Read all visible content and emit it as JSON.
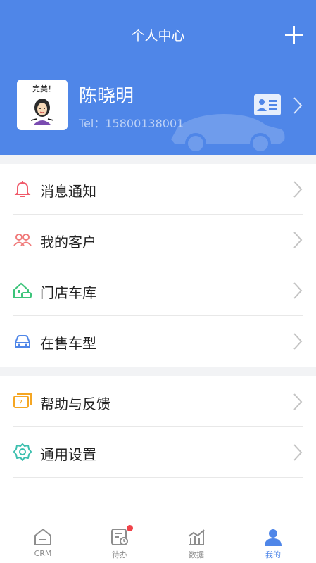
{
  "header": {
    "title": "个人中心",
    "user_name": "陈晓明",
    "user_tel": "Tel：15800138001",
    "avatar_caption": "完美！"
  },
  "menu": [
    {
      "label": "消息通知",
      "icon": "bell-icon",
      "color": "#f05a6a"
    },
    {
      "label": "我的客户",
      "icon": "customers-icon",
      "color": "#f07a7a"
    },
    {
      "label": "门店车库",
      "icon": "garage-icon",
      "color": "#3cc47a"
    },
    {
      "label": "在售车型",
      "icon": "car-icon",
      "color": "#4f86e8"
    },
    {
      "label": "帮助与反馈",
      "icon": "help-feedback-icon",
      "color": "#f5a623"
    },
    {
      "label": "通用设置",
      "icon": "settings-icon",
      "color": "#3cbfae"
    }
  ],
  "tabs": [
    {
      "label": "CRM",
      "icon": "home-icon"
    },
    {
      "label": "待办",
      "icon": "todo-icon"
    },
    {
      "label": "数据",
      "icon": "chart-icon"
    },
    {
      "label": "我的",
      "icon": "user-icon",
      "active": true
    }
  ],
  "colors": {
    "brand": "#4f86e8",
    "badge": "#f0434a"
  }
}
